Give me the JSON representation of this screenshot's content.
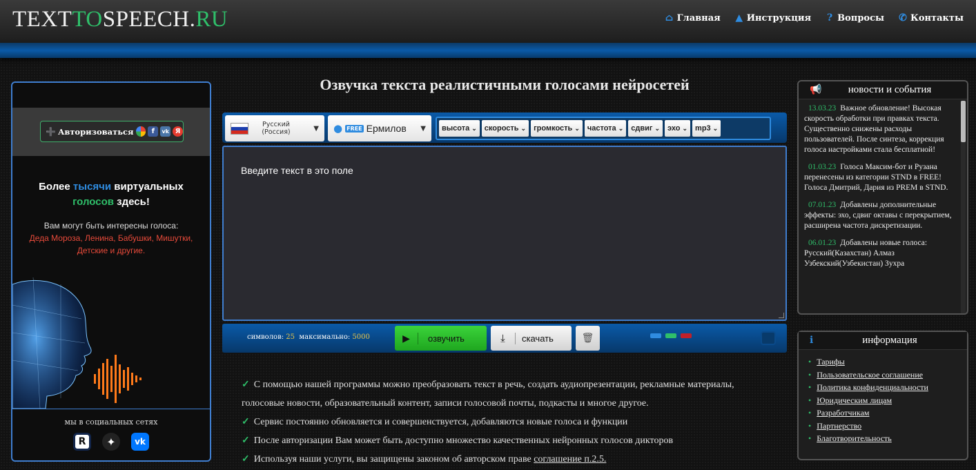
{
  "header": {
    "logo_a": "TEXT",
    "logo_b": "TO",
    "logo_c": "SPEECH.",
    "logo_d": "RU",
    "nav": [
      {
        "label": "Главная",
        "icon": "home-icon"
      },
      {
        "label": "Инструкция",
        "icon": "graduation-cap-icon"
      },
      {
        "label": "Вопросы",
        "icon": "question-icon"
      },
      {
        "label": "Контакты",
        "icon": "phone-icon"
      }
    ]
  },
  "left": {
    "auth_label": "Авторизоваться",
    "promo_part1": "Более ",
    "promo_highlight_blue": "тысячи",
    "promo_part2": " виртуальных",
    "promo_highlight_green": "голосов",
    "promo_part3": " здесь!",
    "promo_sub": "Вам могут быть интересны голоса:",
    "promo_red": "Деда Мороза, Ленина, Бабушки, Мишутки, Детские и другие.",
    "social_title": "мы в социальных сетях"
  },
  "main": {
    "title": "Озвучка текста реалистичными голосами нейросетей",
    "language": "Русский (Россия)",
    "free_badge": "FREE",
    "voice": "Ермилов",
    "params": [
      "высота",
      "скорость",
      "громкость",
      "частота",
      "сдвиг",
      "эхо",
      "mp3"
    ],
    "textarea_value": "Введите текст в это поле",
    "counter_label": "символов:",
    "counter_value": "25",
    "max_label": "максимально:",
    "max_value": "5000",
    "speak_label": "озвучить",
    "download_label": "скачать"
  },
  "features": [
    "С помощью нашей программы можно преобразовать текст в речь, создать аудиопрезентации, рекламные материалы, голосовые новости, образовательный контент, записи голосовой почты, подкасты и многое другое.",
    "Сервис постоянно обновляется и совершенствуется, добавляются новые голоса и функции",
    "После авторизации Вам может быть доступно множество качественных нейронных голосов дикторов"
  ],
  "feature_last_text": "Используя наши услуги, вы защищены законом об авторском праве ",
  "feature_last_link": "соглашение п.2.5.",
  "news": {
    "title": "новости и события",
    "items": [
      {
        "date": "13.03.23",
        "text": "Важное обновление! Высокая скорость обработки при правках текста. Существенно снижены расходы пользователей. После синтеза, коррекция голоса настройками стала бесплатной!"
      },
      {
        "date": "01.03.23",
        "text": "Голоса Максим-бот и Рузана перенесены из категории STND в FREE! Голоса Дмитрий, Дария из PREM в STND."
      },
      {
        "date": "07.01.23",
        "text": "Добавлены дополнительные эффекты: эхо, сдвиг октавы с перекрытием, расширена частота дискретизации."
      },
      {
        "date": "06.01.23",
        "text": "Добавлены новые голоса: Русский(Казахстан) Алмаз Узбекский(Узбекистан) Зухра"
      }
    ]
  },
  "info": {
    "title": "информация",
    "links": [
      "Тарифы",
      "Пользовательское соглашение",
      "Политика конфиденциальности",
      "Юридическим лицам",
      "Разработчикам",
      "Партнерство",
      "Благотворительность"
    ]
  },
  "colors": {
    "accent_blue": "#2f8ce0",
    "accent_green": "#2fbf6a",
    "promo_red": "#e84a3a"
  }
}
